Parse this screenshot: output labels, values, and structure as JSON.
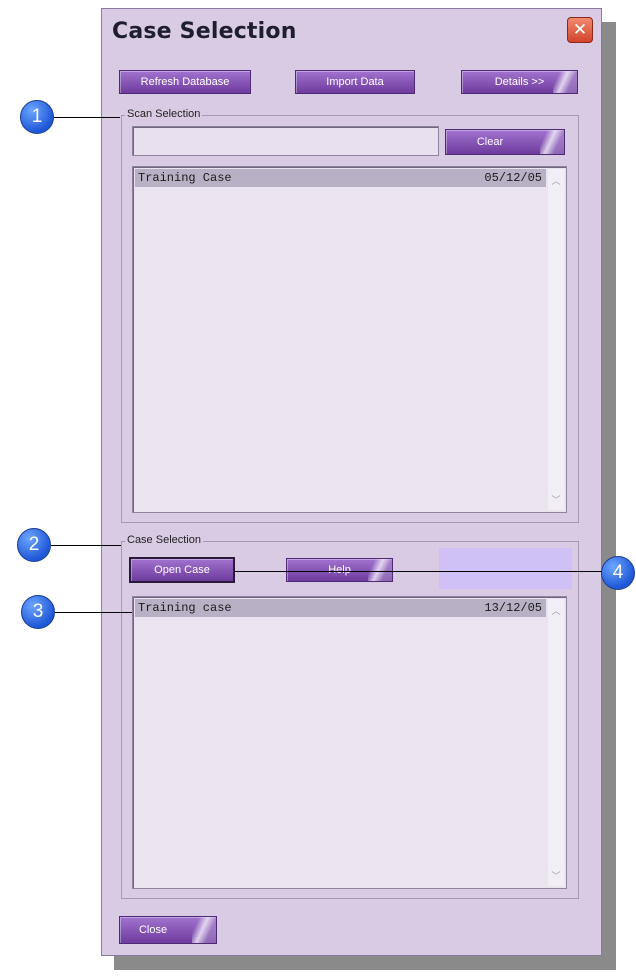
{
  "window": {
    "title": "Case Selection",
    "close_glyph": "✕"
  },
  "toolbar": {
    "refresh_label": "Refresh Database",
    "import_label": "Import Data",
    "details_label": "Details >>"
  },
  "scan_selection": {
    "label": "Scan Selection",
    "search_value": "",
    "clear_label": "Clear",
    "rows": [
      {
        "name": "Training Case",
        "date": "05/12/05"
      }
    ]
  },
  "case_selection": {
    "label": "Case Selection",
    "open_case_label": "Open Case",
    "help_label": "Help",
    "rows": [
      {
        "name": "Training case",
        "date": "13/12/05"
      }
    ]
  },
  "footer": {
    "close_label": "Close"
  },
  "callouts": [
    "1",
    "2",
    "3",
    "4"
  ]
}
